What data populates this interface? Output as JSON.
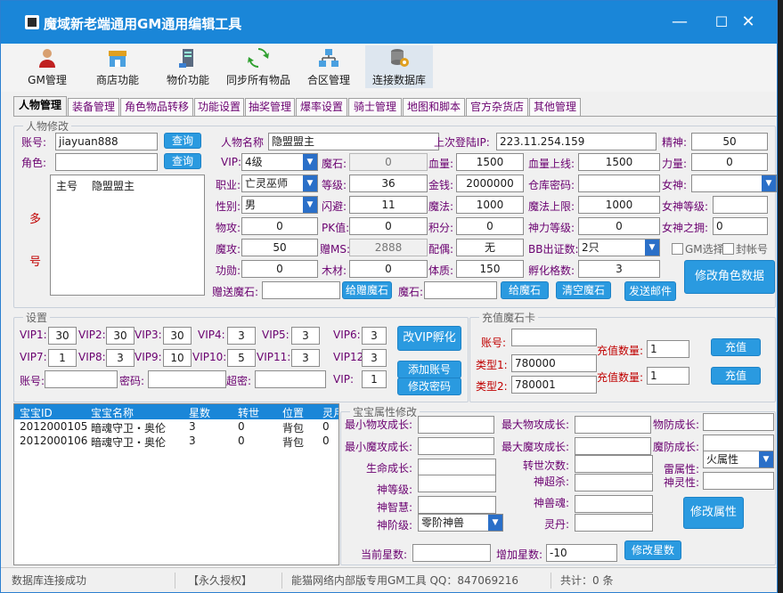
{
  "window": {
    "title": "魔域新老端通用GM通用编辑工具",
    "min": "—",
    "max": "☐",
    "close": "✕"
  },
  "toolbar": [
    "GM管理",
    "商店功能",
    "物价功能",
    "同步所有物品",
    "合区管理",
    "连接数据库"
  ],
  "tabs": [
    "人物管理",
    "装备管理",
    "角色物品转移",
    "功能设置",
    "抽奖管理",
    "爆率设置",
    "骑士管理",
    "地图和脚本",
    "官方杂货店",
    "其他管理"
  ],
  "char": {
    "group": "人物修改",
    "account_label": "账号:",
    "account": "jiayuan888",
    "query": "查询",
    "role_label": "角色:",
    "role": "",
    "query2": "查询",
    "multi": "多",
    "hao": "号",
    "list_header": [
      "主号",
      "隐盟盟主"
    ],
    "name_label": "人物名称",
    "name": "隐盟盟主",
    "last_ip_label": "上次登陆IP:",
    "last_ip": "223.11.254.159",
    "spirit_label": "精神:",
    "spirit": "50",
    "vip_label": "VIP:",
    "vip": "4级",
    "magicstone_label": "魔石:",
    "magicstone": "0",
    "hp_label": "血量:",
    "hp": "1500",
    "hpmax_label": "血量上线:",
    "hpmax": "1500",
    "power_label": "力量:",
    "power": "0",
    "job_label": "职业:",
    "job": "亡灵巫师",
    "level_label": "等级:",
    "level": "36",
    "money_label": "金钱:",
    "money": "2000000",
    "warehouse_label": "仓库密码:",
    "warehouse": "",
    "goddess_label": "女神:",
    "goddess": "",
    "gender_label": "性别:",
    "gender": "男",
    "dodge_label": "闪避:",
    "dodge": "11",
    "mp_label": "魔法:",
    "mp": "1000",
    "mpmax_label": "魔法上限:",
    "mpmax": "1000",
    "goddess_lv_label": "女神等级:",
    "goddess_lv": "",
    "phyatk_label": "物攻:",
    "phyatk": "0",
    "pk_label": "PK值:",
    "pk": "0",
    "points_label": "积分:",
    "points": "0",
    "divine_label": "神力等级:",
    "divine": "0",
    "goddess_hold_label": "女神之拥:",
    "goddess_hold": "0",
    "matk_label": "魔攻:",
    "matk": "50",
    "gift_ms_label": "赠MS:",
    "gift_ms": "2888",
    "spouse_label": "配偶:",
    "spouse": "无",
    "bb_label": "BB出证数:",
    "bb": "2只",
    "gm_select": "GM选择",
    "ban": "封帐号",
    "merit_label": "功勋:",
    "merit": "0",
    "wood_label": "木材:",
    "wood": "0",
    "body_label": "体质:",
    "body": "150",
    "hatch_label": "孵化格数:",
    "hatch": "3",
    "gift_stone_label": "赠送魔石:",
    "gift_stone": "",
    "btn_gift": "给赠魔石",
    "stone_label": "魔石:",
    "stone": "",
    "btn_stone": "给魔石",
    "btn_clear": "清空魔石",
    "btn_mail": "发送邮件",
    "btn_modify": "修改角色数据"
  },
  "settings": {
    "group": "设置",
    "vips": [
      {
        "l": "VIP1:",
        "v": "30"
      },
      {
        "l": "VIP2:",
        "v": "30"
      },
      {
        "l": "VIP3:",
        "v": "30"
      },
      {
        "l": "VIP4:",
        "v": "3"
      },
      {
        "l": "VIP5:",
        "v": "3"
      },
      {
        "l": "VIP6:",
        "v": "3"
      },
      {
        "l": "VIP7:",
        "v": "1"
      },
      {
        "l": "VIP8:",
        "v": "3"
      },
      {
        "l": "VIP9:",
        "v": "10"
      },
      {
        "l": "VIP10:",
        "v": "5"
      },
      {
        "l": "VIP11:",
        "v": "3"
      },
      {
        "l": "VIP12",
        "v": "3"
      }
    ],
    "acc_label": "账号:",
    "acc": "",
    "pwd_label": "密码:",
    "pwd": "",
    "superpwd_label": "超密:",
    "superpwd": "",
    "vip_label": "VIP:",
    "vip": "1",
    "btn_hatch": "改VIP孵化",
    "btn_add": "添加账号",
    "btn_pwd": "修改密码"
  },
  "recharge": {
    "group": "充值魔石卡",
    "acc_label": "账号:",
    "acc": "",
    "type1_label": "类型1:",
    "type1": "780000",
    "qty1_label": "充值数量:",
    "qty1": "1",
    "btn1": "充值",
    "type2_label": "类型2:",
    "type2": "780001",
    "qty2_label": "充值数量:",
    "qty2": "1",
    "btn2": "充值"
  },
  "pets": {
    "headers": [
      "宝宝ID",
      "宝宝名称",
      "星数",
      "转世",
      "位置",
      "灵月"
    ],
    "rows": [
      [
        "2012000105",
        "暗魂守卫・奥伦",
        "3",
        "0",
        "背包",
        "0"
      ],
      [
        "2012000106",
        "暗魂守卫・奥伦",
        "3",
        "0",
        "背包",
        "0"
      ]
    ]
  },
  "petattr": {
    "group": "宝宝属性修改",
    "min_phy_label": "最小物攻成长:",
    "min_phy": "",
    "max_phy_label": "最大物攻成长:",
    "max_phy": "",
    "phydef_label": "物防成长:",
    "phydef": "",
    "min_mag_label": "最小魔攻成长:",
    "min_mag": "",
    "max_mag_label": "最大魔攻成长:",
    "max_mag": "",
    "magdef_label": "魔防成长:",
    "magdef": "",
    "life_label": "生命成长:",
    "life": "",
    "rebirth_label": "转世次数:",
    "rebirth": "",
    "element_label": "雷属性:",
    "element": "火属性",
    "god_lv_label": "神等级:",
    "god_lv": "",
    "god_super_label": "神超杀:",
    "god_super": "",
    "god_spirit_label": "神灵性:",
    "god_spirit": "",
    "god_wis_label": "神智慧:",
    "god_wis": "",
    "god_soul_label": "神兽魂:",
    "god_soul": "",
    "god_rank_label": "神阶级:",
    "god_rank": "零阶神兽",
    "pill_label": "灵丹:",
    "pill": "",
    "btn_modify": "修改属性",
    "cur_star_label": "当前星数:",
    "cur_star": "",
    "add_star_label": "增加星数:",
    "add_star": "-10",
    "btn_star": "修改星数"
  },
  "status": [
    "数据库连接成功",
    "【永久授权】",
    "能猫网络内部版专用GM工具 QQ：847069216",
    "共计：0 条"
  ]
}
